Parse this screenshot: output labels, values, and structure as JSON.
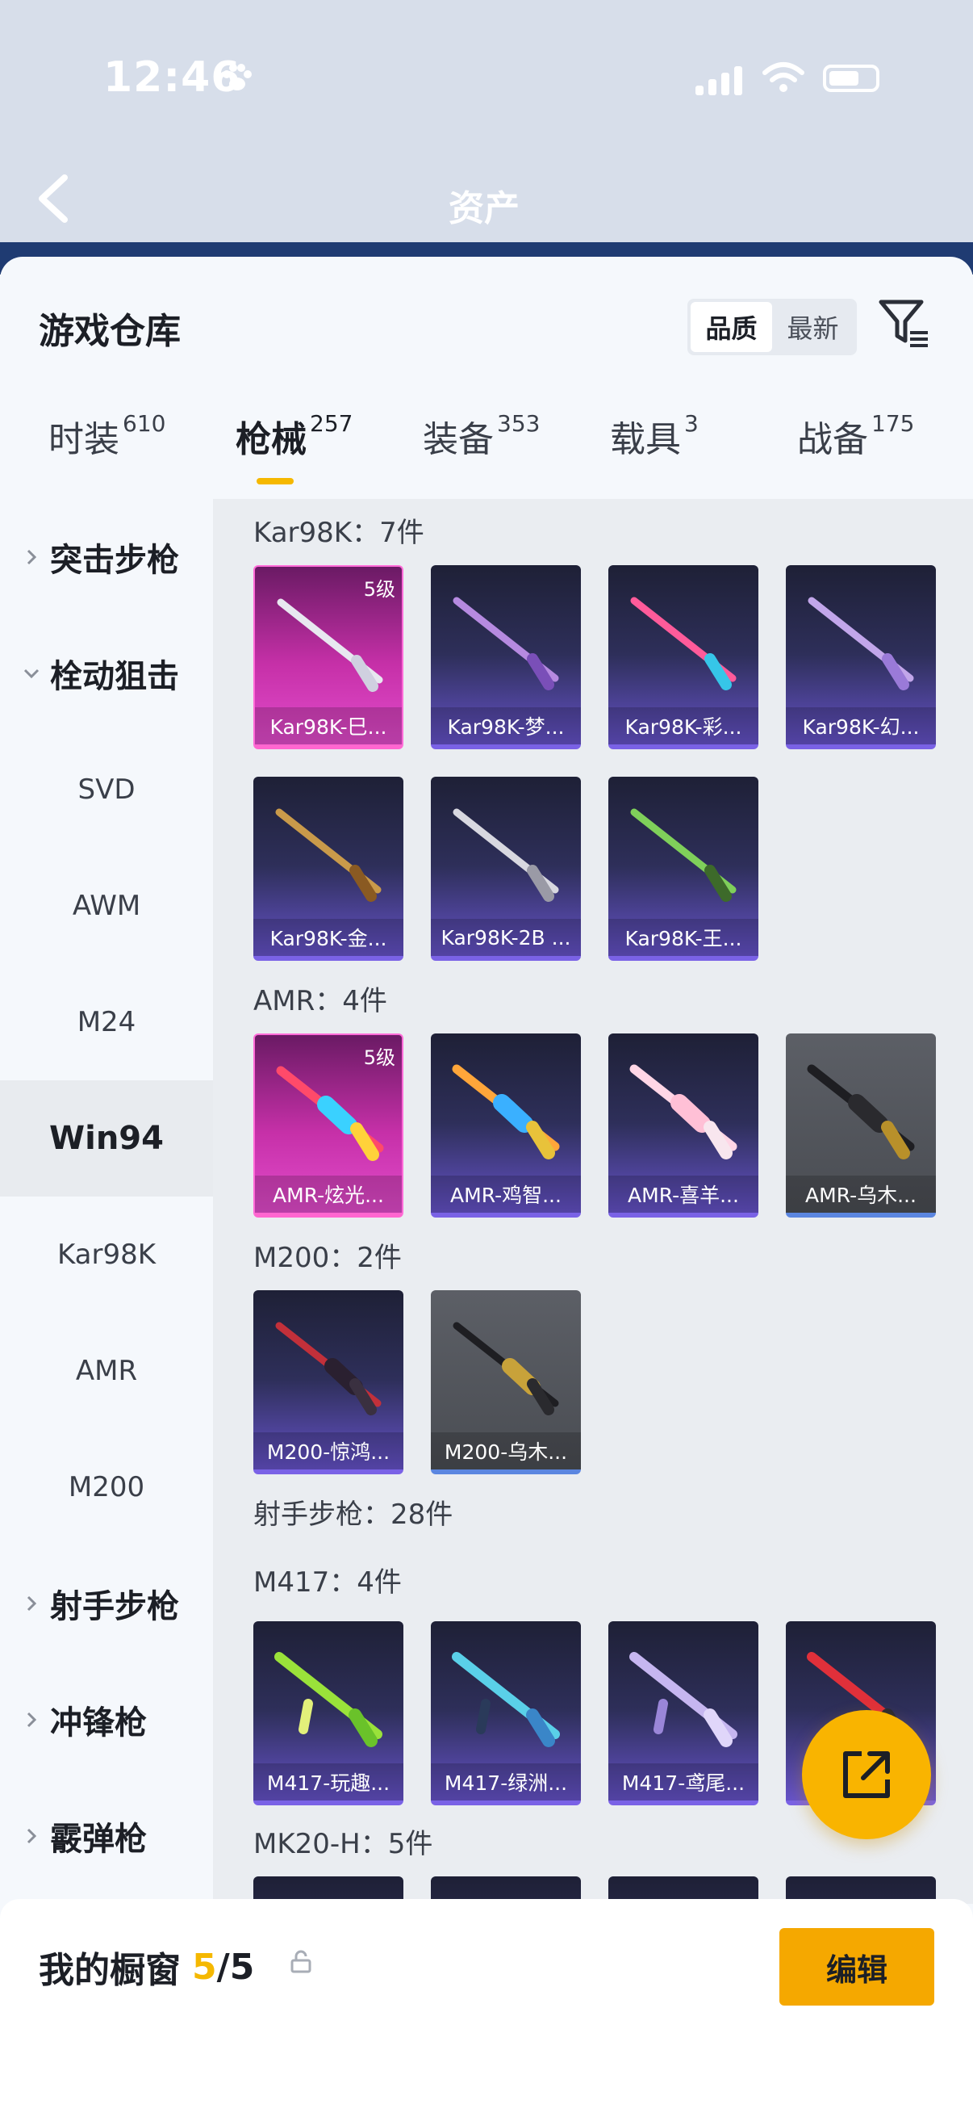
{
  "status": {
    "time": "12:46"
  },
  "header": {
    "title": "资产"
  },
  "sheet": {
    "title": "游戏仓库"
  },
  "sort": {
    "options": [
      "品质",
      "最新"
    ],
    "active": "品质"
  },
  "tabs": [
    {
      "label": "时装",
      "count": "610"
    },
    {
      "label": "枪械",
      "count": "257"
    },
    {
      "label": "装备",
      "count": "353"
    },
    {
      "label": "载具",
      "count": "3"
    },
    {
      "label": "战备",
      "count": "175"
    }
  ],
  "sidebar": {
    "items": [
      {
        "label": "突击步枪",
        "kind": "group"
      },
      {
        "label": "栓动狙击",
        "kind": "group"
      },
      {
        "label": "SVD",
        "kind": "sub"
      },
      {
        "label": "AWM",
        "kind": "sub"
      },
      {
        "label": "M24",
        "kind": "sub"
      },
      {
        "label": "Win94",
        "kind": "sub"
      },
      {
        "label": "Kar98K",
        "kind": "sub"
      },
      {
        "label": "AMR",
        "kind": "sub"
      },
      {
        "label": "M200",
        "kind": "sub"
      },
      {
        "label": "射手步枪",
        "kind": "group"
      },
      {
        "label": "冲锋枪",
        "kind": "group"
      },
      {
        "label": "霰弹枪",
        "kind": "group"
      }
    ]
  },
  "sections": {
    "kar98k": {
      "title": "Kar98K：7件"
    },
    "amr": {
      "title": "AMR：4件"
    },
    "m200": {
      "title": "M200：2件"
    },
    "dmr": {
      "title": "射手步枪：28件"
    },
    "m417": {
      "title": "M417：4件"
    },
    "mk20": {
      "title": "MK20-H：5件"
    }
  },
  "cards": {
    "k1": {
      "name": "Kar98K-巳...",
      "level": "5级",
      "rarity": "pink"
    },
    "k2": {
      "name": "Kar98K-梦...",
      "rarity": "purple"
    },
    "k3": {
      "name": "Kar98K-彩...",
      "rarity": "purple"
    },
    "k4": {
      "name": "Kar98K-幻...",
      "rarity": "purple"
    },
    "k5": {
      "name": "Kar98K-金...",
      "rarity": "purple"
    },
    "k6": {
      "name": "Kar98K-2B ...",
      "rarity": "purple"
    },
    "k7": {
      "name": "Kar98K-王...",
      "rarity": "purple"
    },
    "a1": {
      "name": "AMR-炫光...",
      "level": "5级",
      "rarity": "pink"
    },
    "a2": {
      "name": "AMR-鸡智...",
      "rarity": "purple"
    },
    "a3": {
      "name": "AMR-喜羊...",
      "rarity": "purple"
    },
    "a4": {
      "name": "AMR-乌木...",
      "rarity": "gray"
    },
    "m1": {
      "name": "M200-惊鸿...",
      "rarity": "purple"
    },
    "m2": {
      "name": "M200-乌木...",
      "rarity": "gray"
    },
    "q1": {
      "name": "M417-玩趣...",
      "rarity": "purple"
    },
    "q2": {
      "name": "M417-绿洲...",
      "rarity": "purple"
    },
    "q3": {
      "name": "M417-鸢尾...",
      "rarity": "purple"
    }
  },
  "showcase": {
    "label": "我的橱窗",
    "current": "5",
    "total": "/5"
  },
  "edit_label": "编辑",
  "colors": {
    "accent": "#f5b800",
    "pink_rarity": "#e24ccc",
    "purple_rarity": "#7a62e6",
    "gray_rarity": "#5b86e0"
  }
}
